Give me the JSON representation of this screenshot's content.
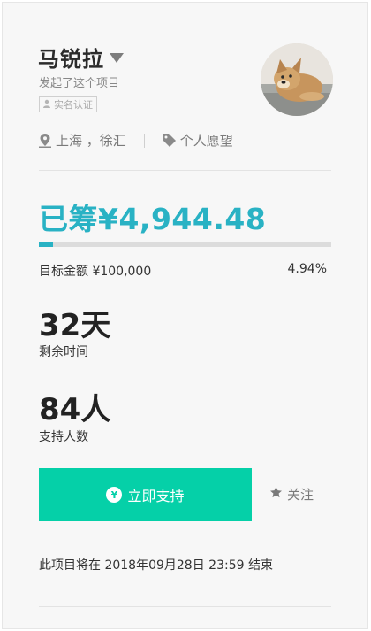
{
  "creator": {
    "name": "马锐拉",
    "subtitle": "发起了这个项目",
    "verified_label": "实名认证"
  },
  "location": {
    "city": "上海 ，徐汇",
    "tag": "个人愿望"
  },
  "funding": {
    "raised": "已筹¥4,944.48",
    "progress_fraction": 0.0494,
    "goal": "目标金额 ¥100,000",
    "percent": "4.94%"
  },
  "stats": {
    "days_value": "32天",
    "days_label": "剩余时间",
    "backers_value": "84人",
    "backers_label": "支持人数"
  },
  "actions": {
    "support_label": "立即支持",
    "support_icon_glyph": "¥",
    "follow_label": "关注"
  },
  "end_text": "此项目将在 2018年09月28日 23:59 结束",
  "colors": {
    "accent_teal": "#29b2c4",
    "button_green": "#05d0a8"
  },
  "icons": [
    "chevron-down-icon",
    "user-icon",
    "location-pin-icon",
    "tag-icon",
    "yen-coin-icon",
    "star-icon"
  ]
}
